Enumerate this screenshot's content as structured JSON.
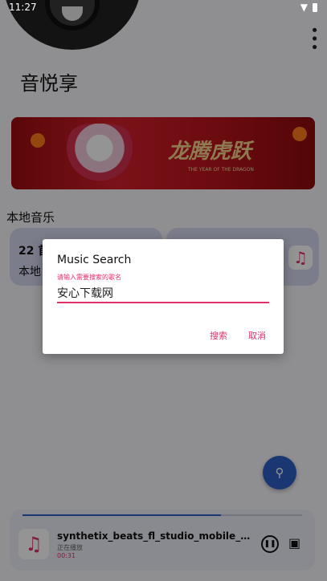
{
  "status_bar": {
    "time": "11:27"
  },
  "app": {
    "title": "音悦享"
  },
  "banner": {
    "calligraphy": "龙腾虎跃",
    "caption": "THE YEAR OF THE DRAGON"
  },
  "section": {
    "title": "本地音乐"
  },
  "cards": [
    {
      "count": "22 首",
      "label": "本地"
    },
    {
      "icon": "music-note-icon"
    }
  ],
  "player": {
    "song": "synthetix_beats_fl_studio_mobile_expansio...",
    "state": "正在播放",
    "time": "00:31",
    "progress": 0.71
  },
  "dialog": {
    "title": "Music Search",
    "hint": "请输入需要搜索的歌名",
    "input_value": "安心下载网",
    "search_label": "搜索",
    "cancel_label": "取消"
  },
  "colors": {
    "accent": "#e0306b",
    "primary": "#2d5fc7",
    "card": "#d6d7ef"
  }
}
